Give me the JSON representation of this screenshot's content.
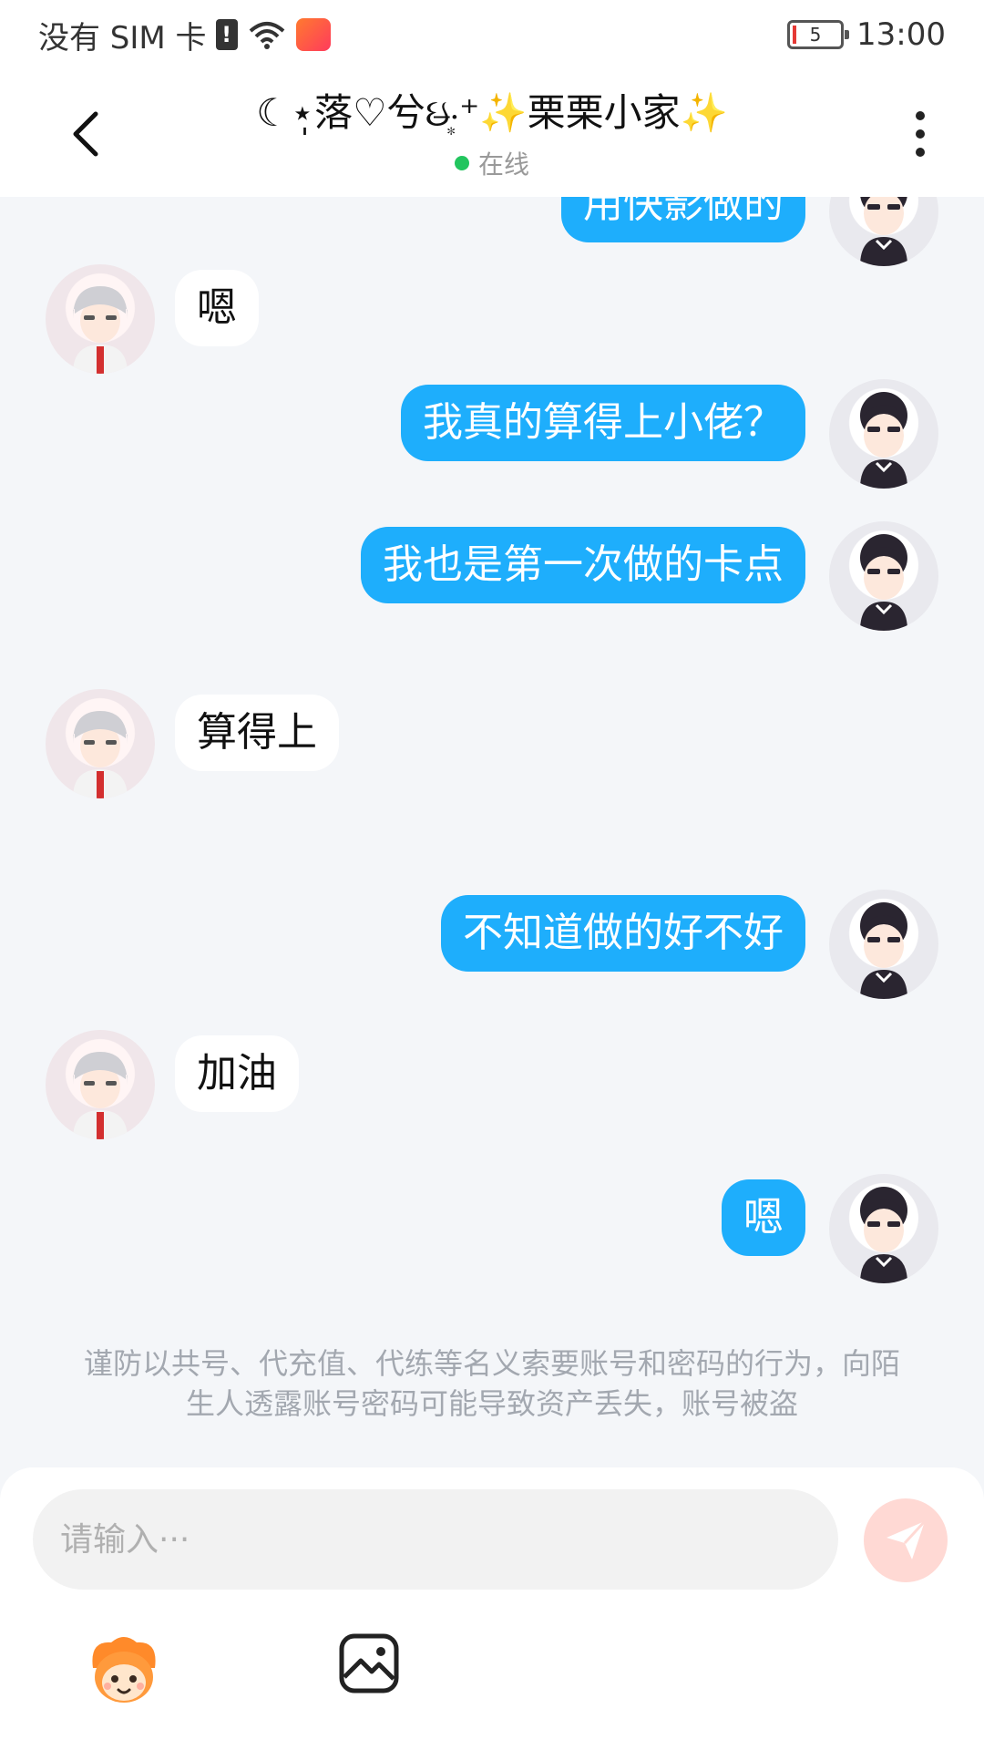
{
  "status_bar": {
    "carrier": "没有 SIM 卡",
    "sim_alert": "!",
    "battery_level": "5",
    "time": "13:00"
  },
  "header": {
    "title": "☾⋆̩落♡兮ઇ̶‧͙⁺✨栗栗小家✨",
    "status": "在线",
    "status_color": "#22c55e"
  },
  "messages": [
    {
      "side": "sent",
      "text": "用快影做的"
    },
    {
      "side": "received",
      "text": "嗯"
    },
    {
      "side": "sent",
      "text": "我真的算得上小佬？"
    },
    {
      "side": "sent",
      "text": "我也是第一次做的卡点"
    },
    {
      "side": "received",
      "text": "算得上"
    },
    {
      "side": "sent",
      "text": "不知道做的好不好"
    },
    {
      "side": "received",
      "text": "加油"
    },
    {
      "side": "sent",
      "text": "嗯"
    }
  ],
  "warning": "谨防以共号、代充值、代练等名义索要账号和密码的行为，向陌生人透露账号密码可能导致资产丢失，账号被盗",
  "input": {
    "placeholder": "请输入···"
  },
  "colors": {
    "sent_bubble": "#1eaefc",
    "received_bubble": "#ffffff",
    "send_button": "#ffd9d4",
    "background": "#f4f6f9"
  },
  "icons": [
    "back-arrow-icon",
    "more-vertical-icon",
    "send-icon",
    "emoji-mascot-icon",
    "image-icon",
    "wifi-icon"
  ]
}
